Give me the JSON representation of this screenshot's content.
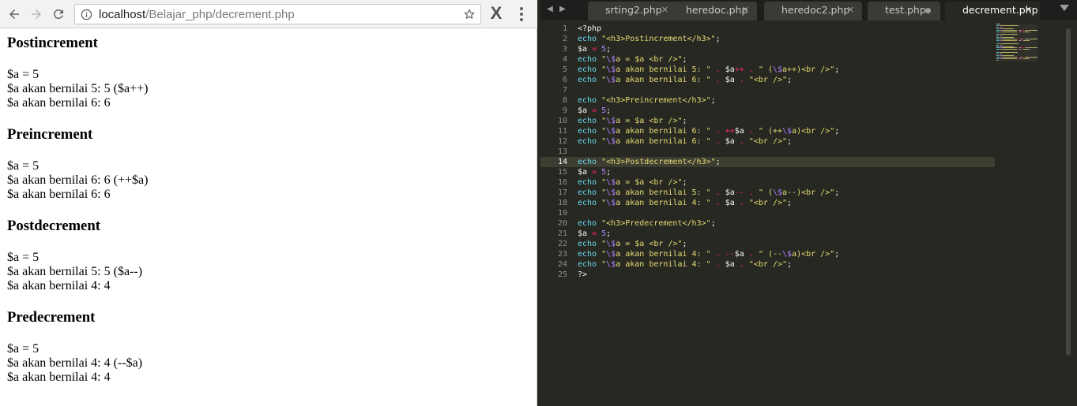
{
  "browser": {
    "url_host": "localhost",
    "url_path": "/Belajar_php/decrement.php",
    "sections": [
      {
        "heading": "Postincrement",
        "lines": [
          "$a = 5",
          "$a akan bernilai 5: 5 ($a++)",
          "$a akan bernilai 6: 6"
        ]
      },
      {
        "heading": "Preincrement",
        "lines": [
          "$a = 5",
          "$a akan bernilai 6: 6 (++$a)",
          "$a akan bernilai 6: 6"
        ]
      },
      {
        "heading": "Postdecrement",
        "lines": [
          "$a = 5",
          "$a akan bernilai 5: 5 ($a--)",
          "$a akan bernilai 4: 4"
        ]
      },
      {
        "heading": "Predecrement",
        "lines": [
          "$a = 5",
          "$a akan bernilai 4: 4 (--$a)",
          "$a akan bernilai 4: 4"
        ]
      }
    ]
  },
  "editor": {
    "tabs": [
      {
        "label": "srting2.php",
        "state": "close"
      },
      {
        "label": "heredoc.php",
        "state": "close"
      },
      {
        "label": "heredoc2.php",
        "state": "close"
      },
      {
        "label": "test.php",
        "state": "modified"
      },
      {
        "label": "decrement.php",
        "state": "close",
        "active": true
      }
    ],
    "current_line": 14,
    "line_numbers": [
      "1",
      "2",
      "3",
      "4",
      "5",
      "6",
      "7",
      "8",
      "9",
      "10",
      "11",
      "12",
      "13",
      "14",
      "15",
      "16",
      "17",
      "18",
      "19",
      "20",
      "21",
      "22",
      "23",
      "24",
      "25"
    ],
    "lines": [
      [
        [
          "p",
          "<?php"
        ]
      ],
      [
        [
          "k",
          "echo"
        ],
        [
          "p",
          " "
        ],
        [
          "s",
          "\"<h3>Postincrement</h3>\""
        ],
        [
          "p",
          ";"
        ]
      ],
      [
        [
          "v",
          "$a"
        ],
        [
          "p",
          " "
        ],
        [
          "o",
          "="
        ],
        [
          "p",
          " "
        ],
        [
          "n",
          "5"
        ],
        [
          "p",
          ";"
        ]
      ],
      [
        [
          "k",
          "echo"
        ],
        [
          "p",
          " "
        ],
        [
          "s",
          "\""
        ],
        [
          "e",
          "\\$"
        ],
        [
          "s",
          "a = $a <br />\""
        ],
        [
          "p",
          ";"
        ]
      ],
      [
        [
          "k",
          "echo"
        ],
        [
          "p",
          " "
        ],
        [
          "s",
          "\""
        ],
        [
          "e",
          "\\$"
        ],
        [
          "s",
          "a akan bernilai 5: \""
        ],
        [
          "p",
          " "
        ],
        [
          "o",
          "."
        ],
        [
          "p",
          " "
        ],
        [
          "v",
          "$a"
        ],
        [
          "o",
          "++"
        ],
        [
          "p",
          " "
        ],
        [
          "o",
          "."
        ],
        [
          "p",
          " "
        ],
        [
          "s",
          "\" ("
        ],
        [
          "e",
          "\\$"
        ],
        [
          "s",
          "a++)<br />\""
        ],
        [
          "p",
          ";"
        ]
      ],
      [
        [
          "k",
          "echo"
        ],
        [
          "p",
          " "
        ],
        [
          "s",
          "\""
        ],
        [
          "e",
          "\\$"
        ],
        [
          "s",
          "a akan bernilai 6: \""
        ],
        [
          "p",
          " "
        ],
        [
          "o",
          "."
        ],
        [
          "p",
          " "
        ],
        [
          "v",
          "$a"
        ],
        [
          "p",
          " "
        ],
        [
          "o",
          "."
        ],
        [
          "p",
          " "
        ],
        [
          "s",
          "\"<br />\""
        ],
        [
          "p",
          ";"
        ]
      ],
      [],
      [
        [
          "k",
          "echo"
        ],
        [
          "p",
          " "
        ],
        [
          "s",
          "\"<h3>Preincrement</h3>\""
        ],
        [
          "p",
          ";"
        ]
      ],
      [
        [
          "v",
          "$a"
        ],
        [
          "p",
          " "
        ],
        [
          "o",
          "="
        ],
        [
          "p",
          " "
        ],
        [
          "n",
          "5"
        ],
        [
          "p",
          ";"
        ]
      ],
      [
        [
          "k",
          "echo"
        ],
        [
          "p",
          " "
        ],
        [
          "s",
          "\""
        ],
        [
          "e",
          "\\$"
        ],
        [
          "s",
          "a = $a <br />\""
        ],
        [
          "p",
          ";"
        ]
      ],
      [
        [
          "k",
          "echo"
        ],
        [
          "p",
          " "
        ],
        [
          "s",
          "\""
        ],
        [
          "e",
          "\\$"
        ],
        [
          "s",
          "a akan bernilai 6: \""
        ],
        [
          "p",
          " "
        ],
        [
          "o",
          "."
        ],
        [
          "p",
          " "
        ],
        [
          "o",
          "++"
        ],
        [
          "v",
          "$a"
        ],
        [
          "p",
          " "
        ],
        [
          "o",
          "."
        ],
        [
          "p",
          " "
        ],
        [
          "s",
          "\" (++"
        ],
        [
          "e",
          "\\$"
        ],
        [
          "s",
          "a)<br />\""
        ],
        [
          "p",
          ";"
        ]
      ],
      [
        [
          "k",
          "echo"
        ],
        [
          "p",
          " "
        ],
        [
          "s",
          "\""
        ],
        [
          "e",
          "\\$"
        ],
        [
          "s",
          "a akan bernilai 6: \""
        ],
        [
          "p",
          " "
        ],
        [
          "o",
          "."
        ],
        [
          "p",
          " "
        ],
        [
          "v",
          "$a"
        ],
        [
          "p",
          " "
        ],
        [
          "o",
          "."
        ],
        [
          "p",
          " "
        ],
        [
          "s",
          "\"<br />\""
        ],
        [
          "p",
          ";"
        ]
      ],
      [],
      [
        [
          "k",
          "echo"
        ],
        [
          "p",
          " "
        ],
        [
          "s",
          "\"<h3>Postdecrement</h3>\""
        ],
        [
          "p",
          ";"
        ]
      ],
      [
        [
          "v",
          "$a"
        ],
        [
          "p",
          " "
        ],
        [
          "o",
          "="
        ],
        [
          "p",
          " "
        ],
        [
          "n",
          "5"
        ],
        [
          "p",
          ";"
        ]
      ],
      [
        [
          "k",
          "echo"
        ],
        [
          "p",
          " "
        ],
        [
          "s",
          "\""
        ],
        [
          "e",
          "\\$"
        ],
        [
          "s",
          "a = $a <br />\""
        ],
        [
          "p",
          ";"
        ]
      ],
      [
        [
          "k",
          "echo"
        ],
        [
          "p",
          " "
        ],
        [
          "s",
          "\""
        ],
        [
          "e",
          "\\$"
        ],
        [
          "s",
          "a akan bernilai 5: \""
        ],
        [
          "p",
          " "
        ],
        [
          "o",
          "."
        ],
        [
          "p",
          " "
        ],
        [
          "v",
          "$a"
        ],
        [
          "o",
          "--"
        ],
        [
          "p",
          " "
        ],
        [
          "o",
          "."
        ],
        [
          "p",
          " "
        ],
        [
          "s",
          "\" ("
        ],
        [
          "e",
          "\\$"
        ],
        [
          "s",
          "a--)<br />\""
        ],
        [
          "p",
          ";"
        ]
      ],
      [
        [
          "k",
          "echo"
        ],
        [
          "p",
          " "
        ],
        [
          "s",
          "\""
        ],
        [
          "e",
          "\\$"
        ],
        [
          "s",
          "a akan bernilai 4: \""
        ],
        [
          "p",
          " "
        ],
        [
          "o",
          "."
        ],
        [
          "p",
          " "
        ],
        [
          "v",
          "$a"
        ],
        [
          "p",
          " "
        ],
        [
          "o",
          "."
        ],
        [
          "p",
          " "
        ],
        [
          "s",
          "\"<br />\""
        ],
        [
          "p",
          ";"
        ]
      ],
      [],
      [
        [
          "k",
          "echo"
        ],
        [
          "p",
          " "
        ],
        [
          "s",
          "\"<h3>Predecrement</h3>\""
        ],
        [
          "p",
          ";"
        ]
      ],
      [
        [
          "v",
          "$a"
        ],
        [
          "p",
          " "
        ],
        [
          "o",
          "="
        ],
        [
          "p",
          " "
        ],
        [
          "n",
          "5"
        ],
        [
          "p",
          ";"
        ]
      ],
      [
        [
          "k",
          "echo"
        ],
        [
          "p",
          " "
        ],
        [
          "s",
          "\""
        ],
        [
          "e",
          "\\$"
        ],
        [
          "s",
          "a = $a <br />\""
        ],
        [
          "p",
          ";"
        ]
      ],
      [
        [
          "k",
          "echo"
        ],
        [
          "p",
          " "
        ],
        [
          "s",
          "\""
        ],
        [
          "e",
          "\\$"
        ],
        [
          "s",
          "a akan bernilai 4: \""
        ],
        [
          "p",
          " "
        ],
        [
          "o",
          "."
        ],
        [
          "p",
          " "
        ],
        [
          "o",
          "--"
        ],
        [
          "v",
          "$a"
        ],
        [
          "p",
          " "
        ],
        [
          "o",
          "."
        ],
        [
          "p",
          " "
        ],
        [
          "s",
          "\" (--"
        ],
        [
          "e",
          "\\$"
        ],
        [
          "s",
          "a)<br />\""
        ],
        [
          "p",
          ";"
        ]
      ],
      [
        [
          "k",
          "echo"
        ],
        [
          "p",
          " "
        ],
        [
          "s",
          "\""
        ],
        [
          "e",
          "\\$"
        ],
        [
          "s",
          "a akan bernilai 4: \""
        ],
        [
          "p",
          " "
        ],
        [
          "o",
          "."
        ],
        [
          "p",
          " "
        ],
        [
          "v",
          "$a"
        ],
        [
          "p",
          " "
        ],
        [
          "o",
          "."
        ],
        [
          "p",
          " "
        ],
        [
          "s",
          "\"<br />\""
        ],
        [
          "p",
          ";"
        ]
      ],
      [
        [
          "p",
          "?>"
        ]
      ]
    ]
  },
  "icons": {
    "back": "arrow-left-icon",
    "forward": "arrow-right-icon",
    "reload": "reload-icon",
    "info": "info-icon",
    "star": "star-icon",
    "extension": "extension-x-icon",
    "menu": "kebab-menu-icon"
  },
  "colors": {
    "editor_bg": "#272822",
    "keyword": "#66d9ef",
    "string": "#e6db74",
    "operator": "#f92672",
    "number": "#ae81ff"
  }
}
